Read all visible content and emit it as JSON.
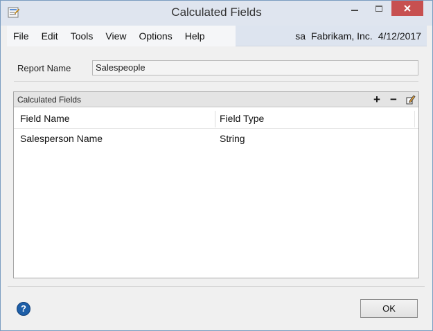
{
  "window": {
    "title": "Calculated Fields",
    "app_icon": "report-app-icon",
    "buttons": {
      "minimize": "minimize-icon",
      "maximize": "maximize-icon",
      "close": "close-icon"
    }
  },
  "menu": {
    "items": [
      "File",
      "Edit",
      "Tools",
      "View",
      "Options",
      "Help"
    ],
    "user": "sa",
    "company": "Fabrikam, Inc.",
    "date": "4/12/2017"
  },
  "form": {
    "report_name_label": "Report Name",
    "report_name_value": "Salespeople"
  },
  "calculated_fields": {
    "title": "Calculated Fields",
    "toolbar": {
      "add": "+",
      "remove": "−",
      "edit_icon": "pencil-icon"
    },
    "columns": [
      "Field Name",
      "Field Type"
    ],
    "rows": [
      {
        "field_name": "Salesperson Name",
        "field_type": "String"
      }
    ]
  },
  "footer": {
    "help_label": "?",
    "ok_label": "OK"
  },
  "colors": {
    "close_button": "#c75050",
    "menubar": "#dde4ef",
    "help_button": "#1e5fa8"
  }
}
